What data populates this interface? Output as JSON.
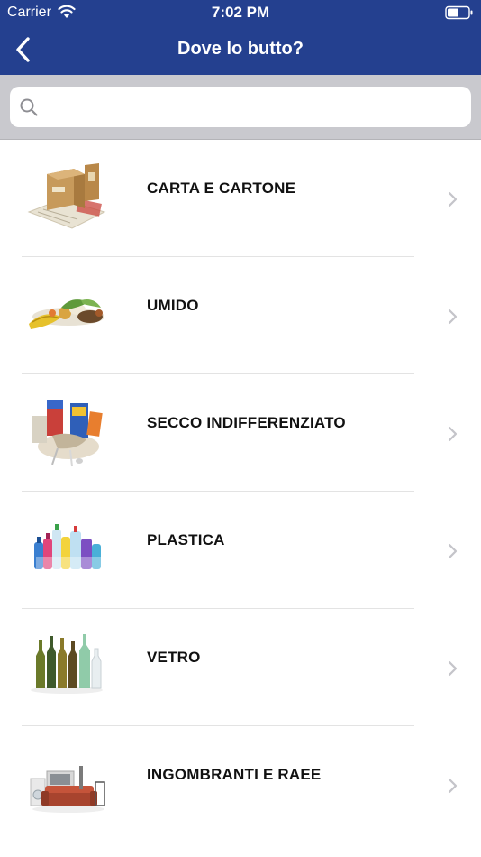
{
  "status_bar": {
    "carrier": "Carrier",
    "time": "7:02 PM"
  },
  "nav": {
    "title": "Dove lo butto?",
    "back_icon": "chevron-left-icon"
  },
  "search": {
    "placeholder": "",
    "value": "",
    "icon": "search-icon"
  },
  "categories": [
    {
      "label": "CARTA E CARTONE",
      "image": "paper-cardboard-image"
    },
    {
      "label": "UMIDO",
      "image": "organic-waste-image"
    },
    {
      "label": "SECCO INDIFFERENZIATO",
      "image": "unsorted-waste-image"
    },
    {
      "label": "PLASTICA",
      "image": "plastic-bottles-image"
    },
    {
      "label": "VETRO",
      "image": "glass-bottles-image"
    },
    {
      "label": "INGOMBRANTI E RAEE",
      "image": "bulky-waste-image"
    }
  ],
  "colors": {
    "header": "#24408f",
    "search_bar_bg": "#c9c9ce"
  }
}
